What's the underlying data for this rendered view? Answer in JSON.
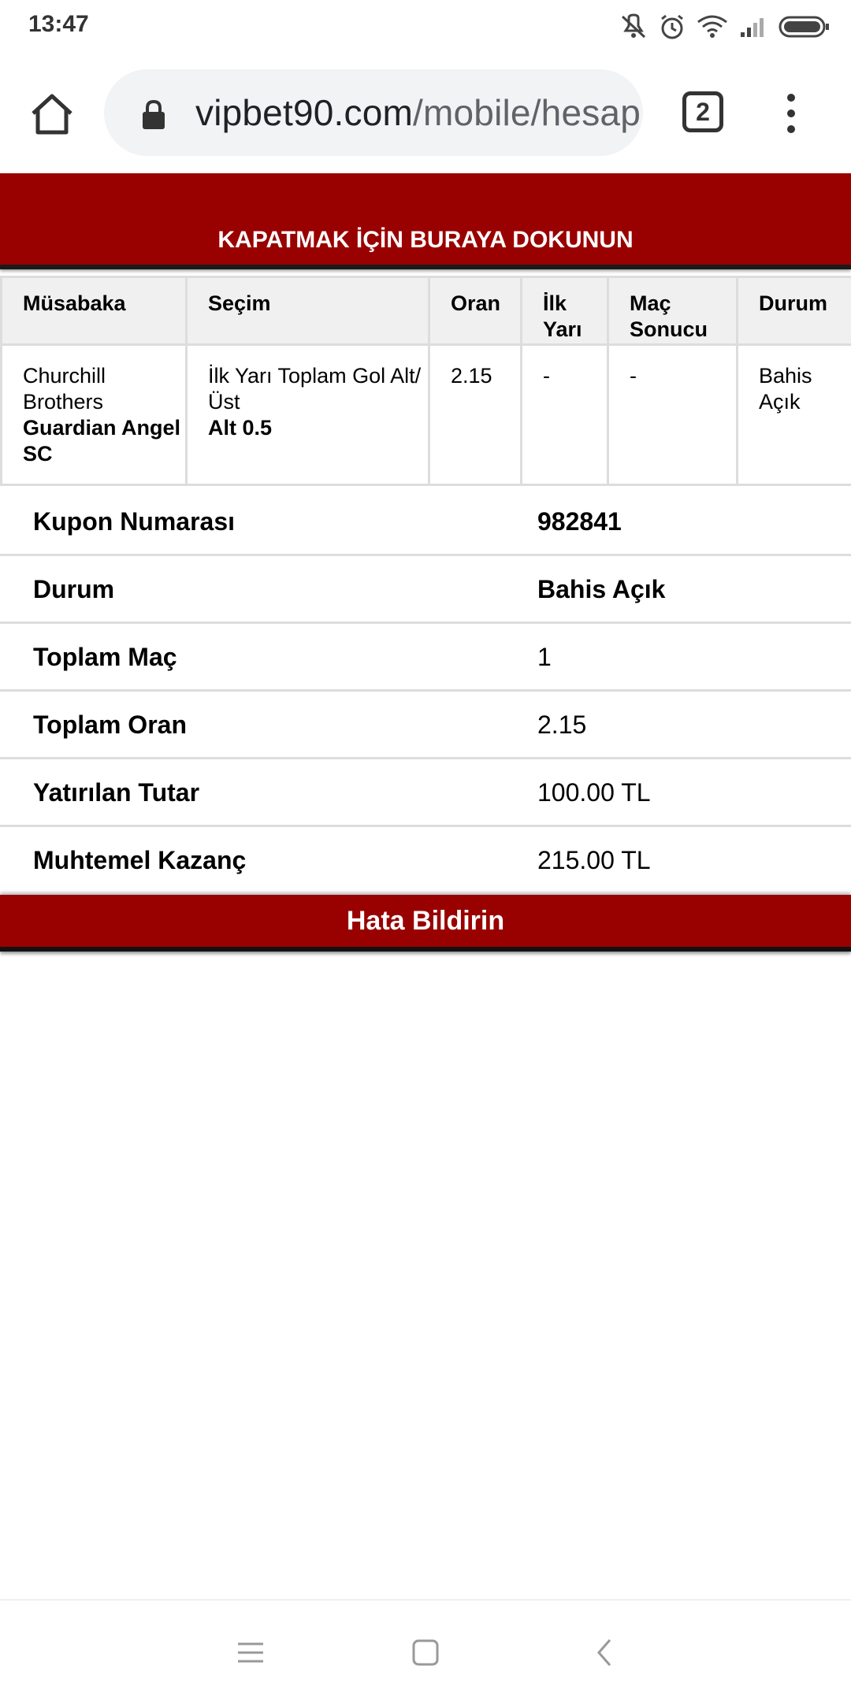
{
  "status": {
    "time": "13:47",
    "icons": [
      "mute-icon",
      "alarm-icon",
      "wifi-icon",
      "signal-icon",
      "battery-icon"
    ]
  },
  "browser": {
    "url_host": "vipbet90.com",
    "url_path": "/mobile/hesap.",
    "tab_count": "2"
  },
  "banner": {
    "close_label": "KAPATMAK İÇİN BURAYA DOKUNUN"
  },
  "bet_table": {
    "headers": {
      "match": "Müsabaka",
      "selection": "Seçim",
      "odds": "Oran",
      "first_half": "İlk Yarı",
      "full_time": "Maç Sonucu",
      "status": "Durum"
    },
    "row": {
      "home_team": "Churchill Brothers",
      "away_team": "Guardian Angel SC",
      "market": "İlk Yarı Toplam Gol Alt/Üst",
      "pick": "Alt 0.5",
      "odds": "2.15",
      "first_half": "-",
      "full_time": "-",
      "status": "Bahis Açık"
    }
  },
  "summary": {
    "coupon_label": "Kupon Numarası",
    "coupon_value": "982841",
    "status_label": "Durum",
    "status_value": "Bahis Açık",
    "total_matches_label": "Toplam Maç",
    "total_matches_value": "1",
    "total_odds_label": "Toplam Oran",
    "total_odds_value": "2.15",
    "stake_label": "Yatırılan Tutar",
    "stake_value": "100.00 TL",
    "potential_win_label": "Muhtemel Kazanç",
    "potential_win_value": "215.00 TL"
  },
  "report": {
    "label": "Hata Bildirin"
  },
  "colors": {
    "accent": "#990000",
    "header_bg": "#f0f0f0",
    "border": "#dddddd"
  }
}
